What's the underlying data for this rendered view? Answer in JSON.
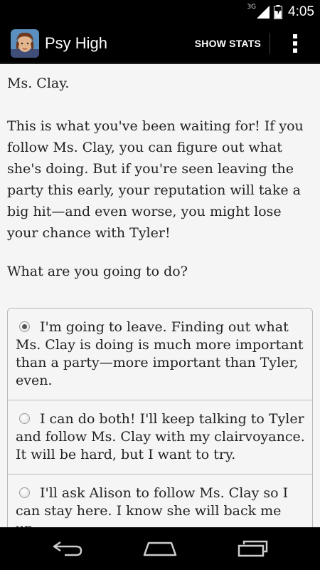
{
  "status_bar": {
    "network": "3G",
    "time": "4:05"
  },
  "action_bar": {
    "app_title": "Psy High",
    "stats_label": "SHOW STATS"
  },
  "story": {
    "paragraphs": [
      "Ms. Clay.",
      "This is what you've been waiting for! If you follow Ms. Clay, you can figure out what she's doing. But if you're seen leaving the party this early, your reputation will take a big hit—and even worse, you might lose your chance with Tyler!"
    ],
    "question": "What are you going to do?"
  },
  "choices": [
    {
      "text": "I'm going to leave. Finding out what Ms. Clay is doing is much more important than a party—more important than Tyler, even.",
      "selected": true
    },
    {
      "text": "I can do both! I'll keep talking to Tyler and follow Ms. Clay with my clairvoyance. It will be hard, but I want to try.",
      "selected": false
    },
    {
      "text": "I'll ask Alison to follow Ms. Clay so I can stay here. I know she will back me up.",
      "selected": false
    }
  ],
  "colors": {
    "background": "#f5f5f5",
    "bars": "#000000",
    "text": "#222222"
  }
}
